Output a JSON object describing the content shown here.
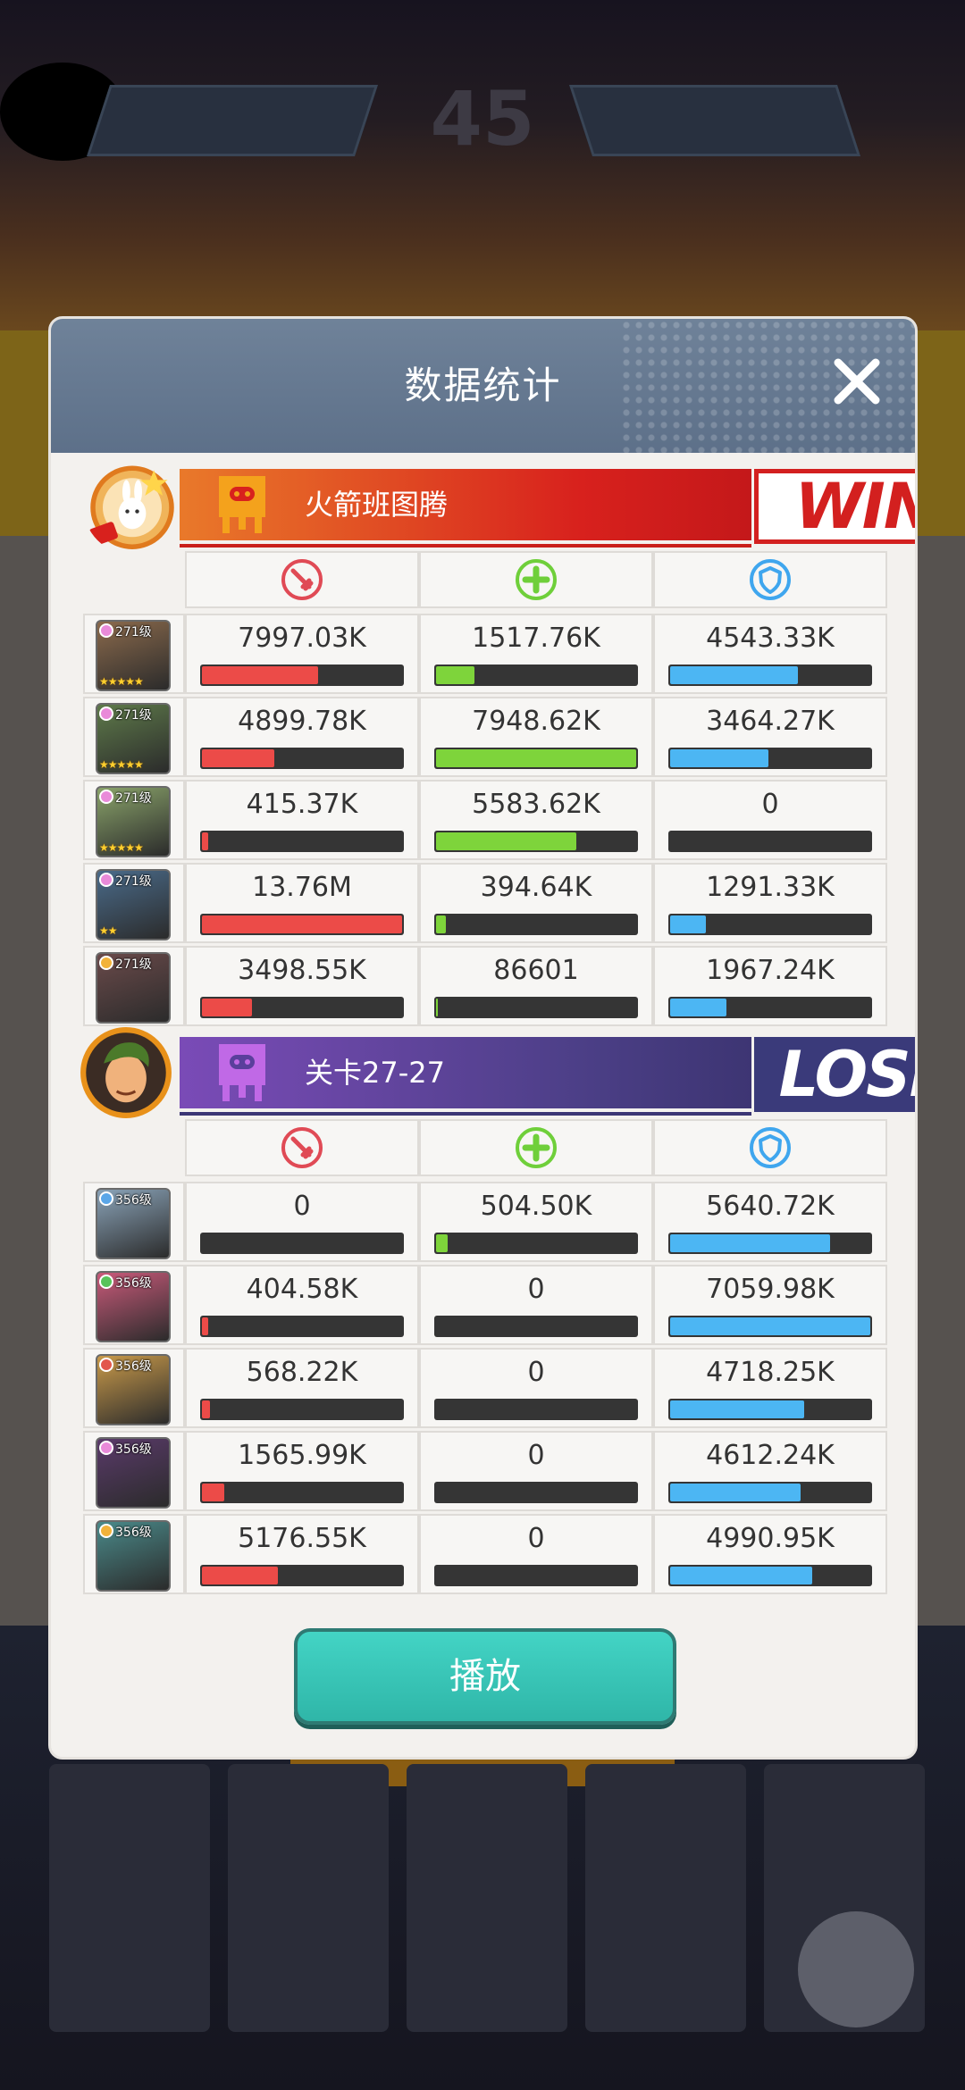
{
  "dialog": {
    "title": "数据统计",
    "play_label": "播放"
  },
  "background": {
    "score": "45"
  },
  "teams": [
    {
      "name": "火箭班图腾",
      "result": "WIN",
      "heroes": [
        {
          "level": "271级",
          "gem": "#e98ad9",
          "stars": "★★★★★",
          "damage": "7997.03K",
          "damage_pct": 0.58,
          "heal": "1517.76K",
          "heal_pct": 0.19,
          "defense": "4543.33K",
          "defense_pct": 0.64
        },
        {
          "level": "271级",
          "gem": "#e98ad9",
          "stars": "★★★★★",
          "damage": "4899.78K",
          "damage_pct": 0.36,
          "heal": "7948.62K",
          "heal_pct": 1.0,
          "defense": "3464.27K",
          "defense_pct": 0.49
        },
        {
          "level": "271级",
          "gem": "#e98ad9",
          "stars": "★★★★★",
          "damage": "415.37K",
          "damage_pct": 0.03,
          "heal": "5583.62K",
          "heal_pct": 0.7,
          "defense": "0",
          "defense_pct": 0.0
        },
        {
          "level": "271级",
          "gem": "#e98ad9",
          "stars": "★★",
          "damage": "13.76M",
          "damage_pct": 1.0,
          "heal": "394.64K",
          "heal_pct": 0.05,
          "defense": "1291.33K",
          "defense_pct": 0.18
        },
        {
          "level": "271级",
          "gem": "#f2b23a",
          "stars": "",
          "damage": "3498.55K",
          "damage_pct": 0.25,
          "heal": "86601",
          "heal_pct": 0.01,
          "defense": "1967.24K",
          "defense_pct": 0.28
        }
      ]
    },
    {
      "name": "关卡27-27",
      "result": "LOSE",
      "heroes": [
        {
          "level": "356级",
          "gem": "#5aa6e8",
          "stars": "",
          "damage": "0",
          "damage_pct": 0.0,
          "heal": "504.50K",
          "heal_pct": 0.06,
          "defense": "5640.72K",
          "defense_pct": 0.8
        },
        {
          "level": "356级",
          "gem": "#58c35a",
          "stars": "",
          "damage": "404.58K",
          "damage_pct": 0.03,
          "heal": "0",
          "heal_pct": 0.0,
          "defense": "7059.98K",
          "defense_pct": 1.0
        },
        {
          "level": "356级",
          "gem": "#e2574c",
          "stars": "",
          "damage": "568.22K",
          "damage_pct": 0.04,
          "heal": "0",
          "heal_pct": 0.0,
          "defense": "4718.25K",
          "defense_pct": 0.67
        },
        {
          "level": "356级",
          "gem": "#e98ad9",
          "stars": "",
          "damage": "1565.99K",
          "damage_pct": 0.11,
          "heal": "0",
          "heal_pct": 0.0,
          "defense": "4612.24K",
          "defense_pct": 0.65
        },
        {
          "level": "356级",
          "gem": "#f2b23a",
          "stars": "",
          "damage": "5176.55K",
          "damage_pct": 0.38,
          "heal": "0",
          "heal_pct": 0.0,
          "defense": "4990.95K",
          "defense_pct": 0.71
        }
      ]
    }
  ],
  "colors": {
    "damage": "#ec4b48",
    "heal": "#7ed43b",
    "defense": "#4cb6f3",
    "win": "#d3201f",
    "lose": "#3a3a7a"
  }
}
